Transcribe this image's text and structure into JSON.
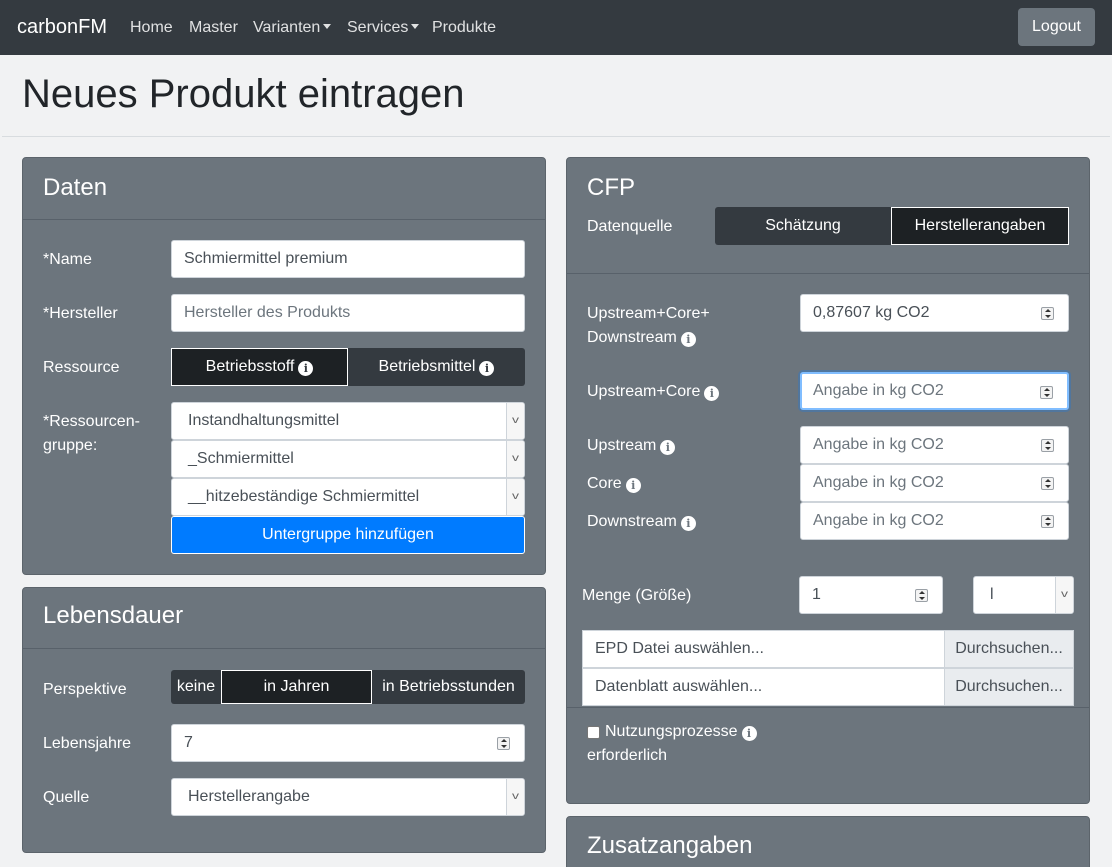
{
  "navbar": {
    "brand": "carbonFM",
    "links": [
      "Home",
      "Master",
      "Varianten",
      "Services",
      "Produkte"
    ],
    "logout": "Logout"
  },
  "page": {
    "title": "Neues Produkt eintragen"
  },
  "daten": {
    "title": "Daten",
    "name_label": "*Name",
    "name_value": "Schmiermittel premium",
    "hersteller_label": "*Hersteller",
    "hersteller_placeholder": "Hersteller des Produkts",
    "ressource_label": "Ressource",
    "ressource_options": [
      "Betriebsstoff",
      "Betriebsmittel"
    ],
    "ressource_selected": "Betriebsstoff",
    "gruppe_label_1": "*Ressourcen-",
    "gruppe_label_2": "gruppe:",
    "gruppe_selects": [
      "Instandhaltungsmittel",
      "_Schmiermittel",
      "__hitzebeständige Schmiermittel"
    ],
    "add_button": "Untergruppe hinzufügen"
  },
  "lebensdauer": {
    "title": "Lebensdauer",
    "perspektive_label": "Perspektive",
    "perspektive_options": [
      "keine",
      "in Jahren",
      "in Betriebsstunden"
    ],
    "perspektive_selected": "in Jahren",
    "jahre_label": "Lebensjahre",
    "jahre_value": "7",
    "quelle_label": "Quelle",
    "quelle_value": "Herstellerangabe"
  },
  "cfp": {
    "title": "CFP",
    "datenquelle_label": "Datenquelle",
    "datenquelle_options": [
      "Schätzung",
      "Herstellerangaben"
    ],
    "datenquelle_selected": "Herstellerangaben",
    "usd_label_1": "Upstream+Core+",
    "usd_label_2": "Downstream",
    "usd_value": "0,87607 kg CO2",
    "uc_label": "Upstream+Core",
    "upstream_label": "Upstream",
    "core_label": "Core",
    "downstream_label": "Downstream",
    "placeholder": "Angabe in kg CO2",
    "menge_label": "Menge (Größe)",
    "menge_value": "1",
    "unit_value": "l",
    "epd_label": "EPD Datei auswählen...",
    "datenblatt_label": "Datenblatt auswählen...",
    "browse_label": "Durchsuchen...",
    "nutzung_label_1": "Nutzungsprozesse",
    "nutzung_label_2": "erforderlich"
  },
  "zusatz": {
    "title": "Zusatzangaben"
  }
}
